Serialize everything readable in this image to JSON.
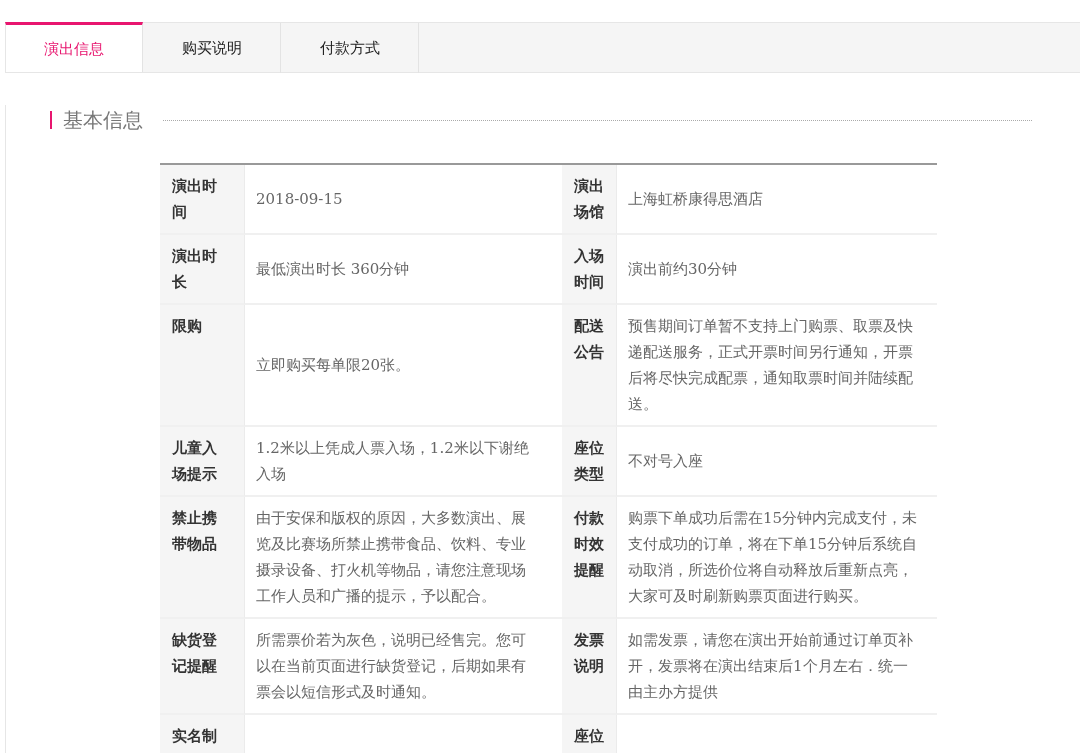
{
  "tabs": [
    {
      "label": "演出信息",
      "selected": true
    },
    {
      "label": "购买说明",
      "selected": false
    },
    {
      "label": "付款方式",
      "selected": false
    }
  ],
  "section": {
    "title": "基本信息"
  },
  "table": {
    "rows": [
      {
        "left": {
          "label": "演出时间",
          "value": "2018-09-15"
        },
        "right": {
          "label": "演出场馆",
          "value": "上海虹桥康得思酒店"
        }
      },
      {
        "left": {
          "label": "演出时长",
          "value": "最低演出时长 360分钟"
        },
        "right": {
          "label": "入场时间",
          "value": "演出前约30分钟"
        }
      },
      {
        "left": {
          "label": "限购",
          "value": "立即购买每单限20张。"
        },
        "right": {
          "label": "配送公告",
          "value": "预售期间订单暂不支持上门购票、取票及快递配送服务，正式开票时间另行通知，开票后将尽快完成配票，通知取票时间并陆续配送。"
        }
      },
      {
        "left": {
          "label": "儿童入场提示",
          "value": "1.2米以上凭成人票入场，1.2米以下谢绝入场"
        },
        "right": {
          "label": "座位类型",
          "value": "不对号入座"
        }
      },
      {
        "left": {
          "label": "禁止携带物品",
          "value": "由于安保和版权的原因，大多数演出、展览及比赛场所禁止携带食品、饮料、专业摄录设备、打火机等物品，请您注意现场工作人员和广播的提示，予以配合。"
        },
        "right": {
          "label": "付款时效提醒",
          "value": "购票下单成功后需在15分钟内完成支付，未支付成功的订单，将在下单15分钟后系统自动取消，所选价位将自动释放后重新点亮，大家可及时刷新购票页面进行购买。"
        }
      },
      {
        "left": {
          "label": "缺货登记提醒",
          "value": "所需票价若为灰色，说明已经售完。您可以在当前页面进行缺货登记，后期如果有票会以短信形式及时通知。"
        },
        "right": {
          "label": "发票说明",
          "value": "如需发票，请您在演出开始前通过订单页补开，发票将在演出结束后1个月左右．统一由主办方提供"
        }
      },
      {
        "left": {
          "label": "实名制"
        },
        "right": {
          "label": "座位"
        }
      }
    ]
  }
}
